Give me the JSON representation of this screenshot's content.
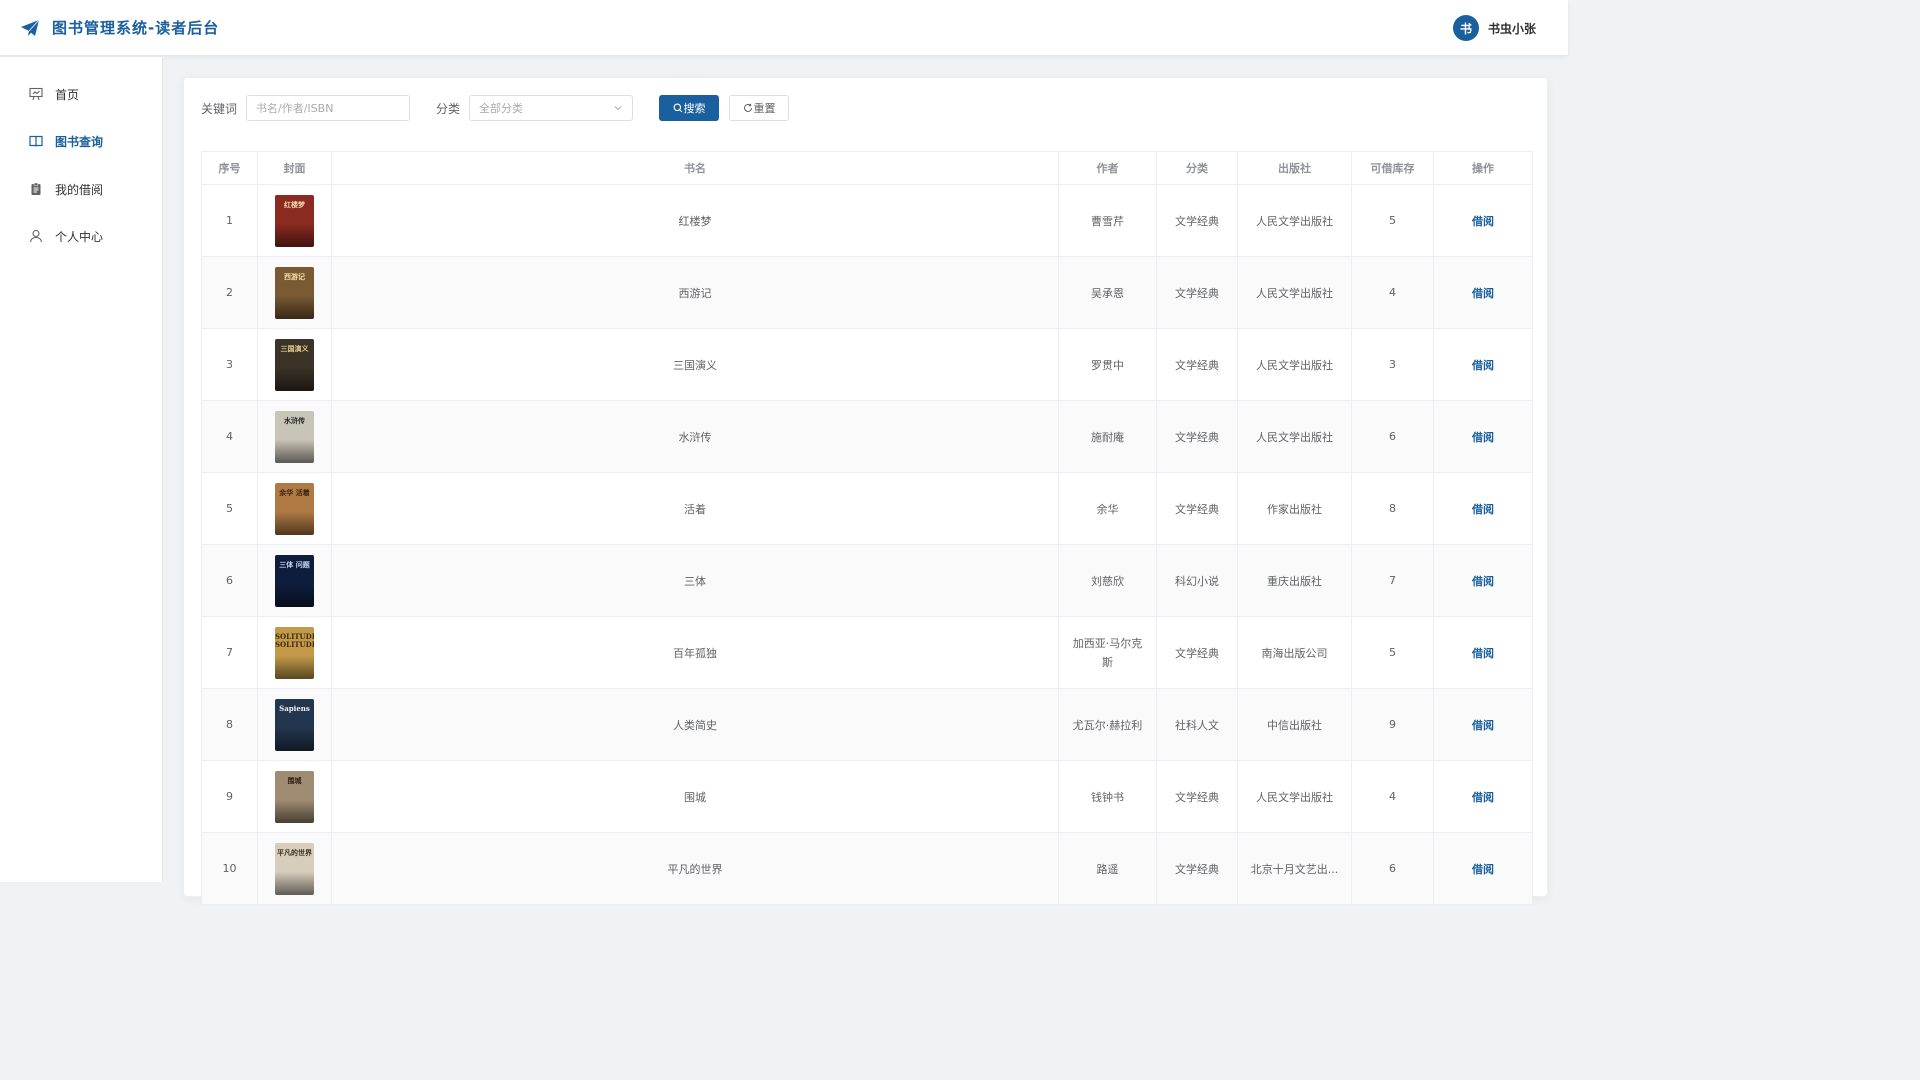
{
  "app": {
    "title": "图书管理系统-读者后台",
    "accent": "#1a5f9e"
  },
  "user": {
    "avatar_char": "书",
    "name": "书虫小张"
  },
  "sidebar": {
    "items": [
      {
        "label": "首页",
        "icon": "presentation-icon",
        "active": false
      },
      {
        "label": "图书查询",
        "icon": "book-open-icon",
        "active": true
      },
      {
        "label": "我的借阅",
        "icon": "clipboard-icon",
        "active": false
      },
      {
        "label": "个人中心",
        "icon": "user-icon",
        "active": false
      }
    ]
  },
  "search": {
    "keyword_label": "关键词",
    "keyword_placeholder": "书名/作者/ISBN",
    "category_label": "分类",
    "category_value": "全部分类",
    "search_button": "搜索",
    "reset_button": "重置"
  },
  "table": {
    "columns": [
      "序号",
      "封面",
      "书名",
      "作者",
      "分类",
      "出版社",
      "可借库存",
      "操作"
    ],
    "rows": [
      {
        "no": "1",
        "cover_text": "红楼梦",
        "title": "红楼梦",
        "author": "曹雪芹",
        "category": "文学经典",
        "publisher": "人民文学出版社",
        "stock": "5",
        "action": "借阅"
      },
      {
        "no": "2",
        "cover_text": "西游记",
        "title": "西游记",
        "author": "吴承恩",
        "category": "文学经典",
        "publisher": "人民文学出版社",
        "stock": "4",
        "action": "借阅"
      },
      {
        "no": "3",
        "cover_text": "三国演义",
        "title": "三国演义",
        "author": "罗贯中",
        "category": "文学经典",
        "publisher": "人民文学出版社",
        "stock": "3",
        "action": "借阅"
      },
      {
        "no": "4",
        "cover_text": "水浒传",
        "title": "水浒传",
        "author": "施耐庵",
        "category": "文学经典",
        "publisher": "人民文学出版社",
        "stock": "6",
        "action": "借阅"
      },
      {
        "no": "5",
        "cover_text": "余华 活着",
        "title": "活着",
        "author": "余华",
        "category": "文学经典",
        "publisher": "作家出版社",
        "stock": "8",
        "action": "借阅"
      },
      {
        "no": "6",
        "cover_text": "三体 问题",
        "title": "三体",
        "author": "刘慈欣",
        "category": "科幻小说",
        "publisher": "重庆出版社",
        "stock": "7",
        "action": "借阅"
      },
      {
        "no": "7",
        "cover_text": "SOLITUDE SOLITUDE",
        "title": "百年孤独",
        "author": "加西亚·马尔克斯",
        "category": "文学经典",
        "publisher": "南海出版公司",
        "stock": "5",
        "action": "借阅"
      },
      {
        "no": "8",
        "cover_text": "Sapiens",
        "title": "人类简史",
        "author": "尤瓦尔·赫拉利",
        "category": "社科人文",
        "publisher": "中信出版社",
        "stock": "9",
        "action": "借阅"
      },
      {
        "no": "9",
        "cover_text": "围城",
        "title": "围城",
        "author": "钱钟书",
        "category": "文学经典",
        "publisher": "人民文学出版社",
        "stock": "4",
        "action": "借阅"
      },
      {
        "no": "10",
        "cover_text": "平凡的世界",
        "title": "平凡的世界",
        "author": "路遥",
        "category": "文学经典",
        "publisher": "北京十月文艺出...",
        "stock": "6",
        "action": "借阅"
      }
    ]
  },
  "cover_colors": [
    {
      "bg": "#8b2a20",
      "fg": "#f1d9a8"
    },
    {
      "bg": "#7a5a32",
      "fg": "#f3dfb0"
    },
    {
      "bg": "#3b3328",
      "fg": "#e8cf8c"
    },
    {
      "bg": "#c9c4b8",
      "fg": "#222222"
    },
    {
      "bg": "#b07a45",
      "fg": "#3a2414"
    },
    {
      "bg": "#0e1d3c",
      "fg": "#c7d6f5"
    },
    {
      "bg": "#c49a4a",
      "fg": "#3a2a10"
    },
    {
      "bg": "#23364f",
      "fg": "#f2f2f2"
    },
    {
      "bg": "#a08c72",
      "fg": "#2a2016"
    },
    {
      "bg": "#d7cdbc",
      "fg": "#3a2f22"
    }
  ]
}
